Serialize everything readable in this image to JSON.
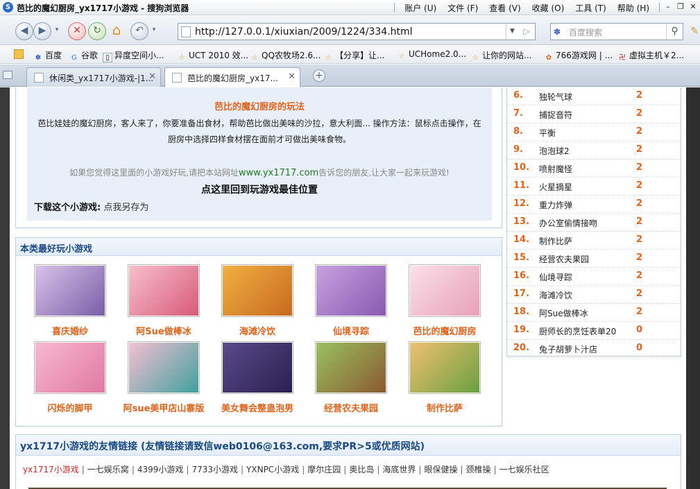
{
  "window": {
    "title": "芭比的魔幻厨房_yx1717小游戏 - 搜狗浏览器",
    "menu": [
      "账户 (U)",
      "文件 (F)",
      "查看 (V)",
      "收藏 (O)",
      "工具 (T)",
      "帮助 (H)"
    ]
  },
  "nav": {
    "url": "http://127.0.0.1/xiuxian/2009/1224/334.html",
    "search_placeholder": "百度搜索"
  },
  "favorites": [
    "百度",
    "谷歌",
    "异度空间小...",
    "UCT 2010 效...",
    "QQ农牧场2.6...",
    "【分享】让...",
    "UCHome2.0...",
    "让你的网站...",
    "766游戏网 | ...",
    "虚拟主机￥2..."
  ],
  "tabs": [
    {
      "label": "休闲类_yx1717小游戏-|1..."
    },
    {
      "label": "芭比的魔幻厨房_yx17..."
    }
  ],
  "intro": {
    "heading": "芭比的魔幻厨房的玩法",
    "desc": "芭比娃娃的魔幻厨房，客人来了，你要准备出食材，帮助芭比做出美味的沙拉，意大利面... 操作方法：鼠标点击操作，在厨房中选择四样食材摆在面前才可做出美味食物。",
    "tip_pre": "如果您觉得这里面的小游戏好玩,请把本站网址",
    "tip_url": "www.yx1717.com",
    "tip_post": "告诉您的朋友,让大家一起来玩游戏!",
    "back_link": "点这里回到玩游戏最佳位置",
    "download_label": "下载这个小游戏:",
    "download_link": "点我另存为"
  },
  "best": {
    "title": "本类最好玩小游戏",
    "games": [
      {
        "name": "喜庆婚纱",
        "colors": [
          "#d8c3e8",
          "#7a5ea8"
        ]
      },
      {
        "name": "阿Sue做棒冰",
        "colors": [
          "#f7c0c8",
          "#d85a7a"
        ]
      },
      {
        "name": "海滩冷饮",
        "colors": [
          "#f0b040",
          "#c86a20"
        ]
      },
      {
        "name": "仙境寻踪",
        "colors": [
          "#c8a0e0",
          "#8a5ab0"
        ]
      },
      {
        "name": "芭比的魔幻厨房",
        "colors": [
          "#fbe0e8",
          "#e8a0b8"
        ]
      },
      {
        "name": "闪烁的脚甲",
        "colors": [
          "#f8b8d0",
          "#e07aa0"
        ]
      },
      {
        "name": "阿sue美甲店山寨版",
        "colors": [
          "#f5c0d0",
          "#40a0a0"
        ]
      },
      {
        "name": "美女舞会整蛊泡男",
        "colors": [
          "#5a4a8a",
          "#2a2050"
        ]
      },
      {
        "name": "经营农夫果园",
        "colors": [
          "#9ac060",
          "#8a5a30"
        ]
      },
      {
        "name": "制作比萨",
        "colors": [
          "#f0c070",
          "#6aa040"
        ]
      }
    ]
  },
  "ranking": [
    {
      "no": "6.",
      "title": "独轮气球",
      "count": "2"
    },
    {
      "no": "7.",
      "title": "捕捉音符",
      "count": "2"
    },
    {
      "no": "8.",
      "title": "平衡",
      "count": "2"
    },
    {
      "no": "9.",
      "title": "泡泡球2",
      "count": "2"
    },
    {
      "no": "10.",
      "title": "喷射魔怪",
      "count": "2"
    },
    {
      "no": "11.",
      "title": "火星摘星",
      "count": "2"
    },
    {
      "no": "12.",
      "title": "重力炸弹",
      "count": "2"
    },
    {
      "no": "13.",
      "title": "办公室偷情接吻",
      "count": "2"
    },
    {
      "no": "14.",
      "title": "制作比萨",
      "count": "2"
    },
    {
      "no": "15.",
      "title": "经营农夫果园",
      "count": "2"
    },
    {
      "no": "16.",
      "title": "仙境寻踪",
      "count": "2"
    },
    {
      "no": "17.",
      "title": "海滩冷饮",
      "count": "2"
    },
    {
      "no": "18.",
      "title": "阿Sue做棒冰",
      "count": "2"
    },
    {
      "no": "19.",
      "title": "厨师长的烹饪表单20",
      "count": "0"
    },
    {
      "no": "20.",
      "title": "兔子胡萝卜汁店",
      "count": "0"
    }
  ],
  "friend_links": {
    "title": "yx1717小游戏的友情链接 (友情链接请致信web0106@163.com,要求PR>5或优质网站)",
    "items": [
      "yx1717小游戏",
      "一七娱乐窝",
      "4399小游戏",
      "7733小游戏",
      "YXNPC小游戏",
      "摩尔庄园",
      "奥比岛",
      "海底世界",
      "眼保健操",
      "颈椎操",
      "一七娱乐社区"
    ]
  }
}
